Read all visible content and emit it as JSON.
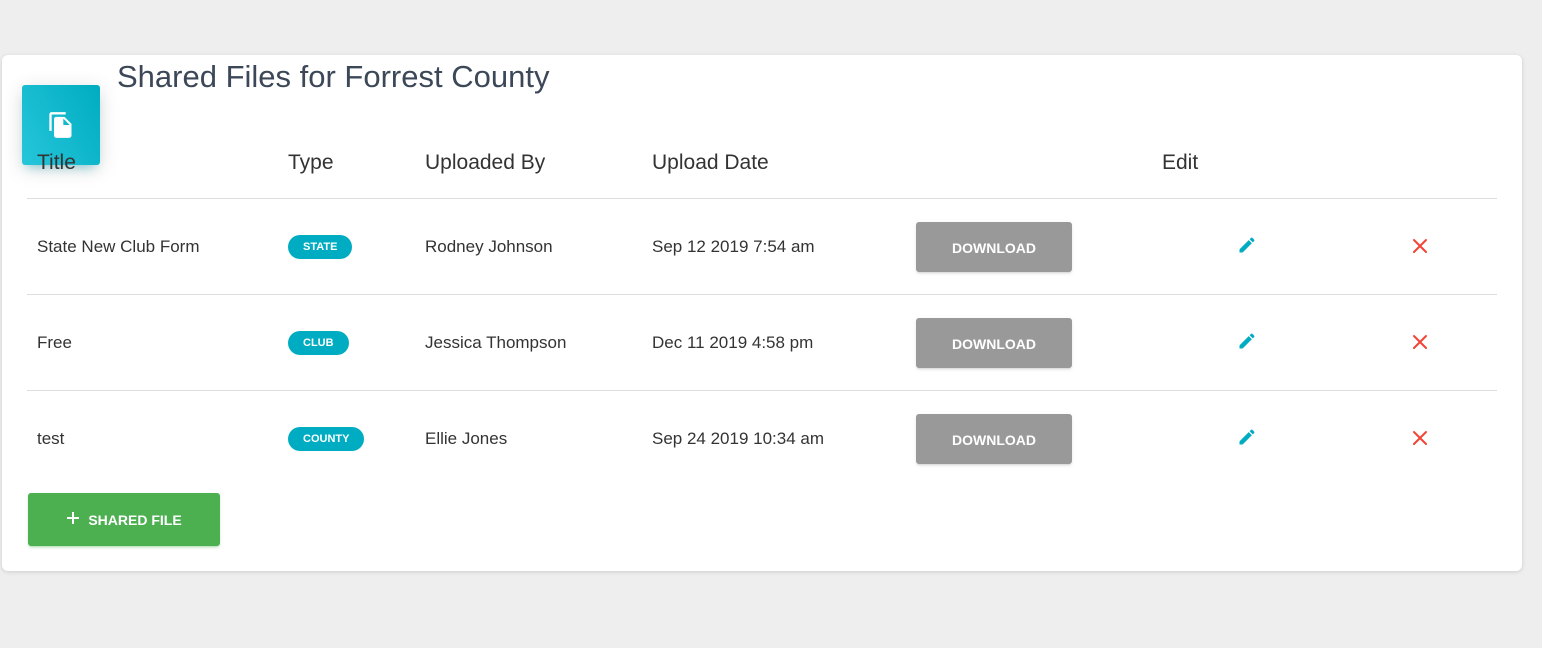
{
  "page": {
    "title": "Shared Files for Forrest County"
  },
  "table": {
    "headers": {
      "title": "Title",
      "type": "Type",
      "uploaded_by": "Uploaded By",
      "upload_date": "Upload Date",
      "edit": "Edit"
    },
    "rows": [
      {
        "title": "State New Club Form",
        "type": "STATE",
        "uploaded_by": "Rodney Johnson",
        "upload_date": "Sep 12 2019 7:54 am",
        "download_label": "DOWNLOAD"
      },
      {
        "title": "Free",
        "type": "CLUB",
        "uploaded_by": "Jessica Thompson",
        "upload_date": "Dec 11 2019 4:58 pm",
        "download_label": "DOWNLOAD"
      },
      {
        "title": "test",
        "type": "COUNTY",
        "uploaded_by": "Ellie Jones",
        "upload_date": "Sep 24 2019 10:34 am",
        "download_label": "DOWNLOAD"
      }
    ]
  },
  "actions": {
    "add_label": "SHARED FILE"
  },
  "icons": {
    "header": "file-copy-icon",
    "edit": "pencil-icon",
    "delete": "close-icon",
    "add": "plus-icon"
  },
  "colors": {
    "accent": "#00acc1",
    "download": "#999999",
    "add": "#4caf50",
    "delete": "#f44336",
    "edit": "#00acc1",
    "background": "#eeeeee"
  }
}
